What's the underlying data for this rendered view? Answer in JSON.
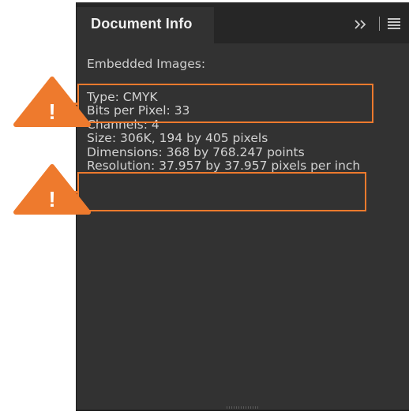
{
  "panel": {
    "tab_title": "Document Info",
    "collapse_icon": "double-chevron-right-icon",
    "menu_icon": "hamburger-menu-icon"
  },
  "content": {
    "heading": "Embedded Images:",
    "lines": [
      "Type: CMYK",
      "Bits per Pixel: 33",
      "Channels: 4",
      "Size: 306K, 194 by 405 pixels",
      "Dimensions: 368 by 768.247 points",
      "Resolution: 37.957 by 37.957 pixels per inch"
    ]
  },
  "annotations": {
    "warning_icon": "warning-triangle-icon",
    "warning_symbol": "!",
    "highlight_color": "#ee7a2d"
  }
}
